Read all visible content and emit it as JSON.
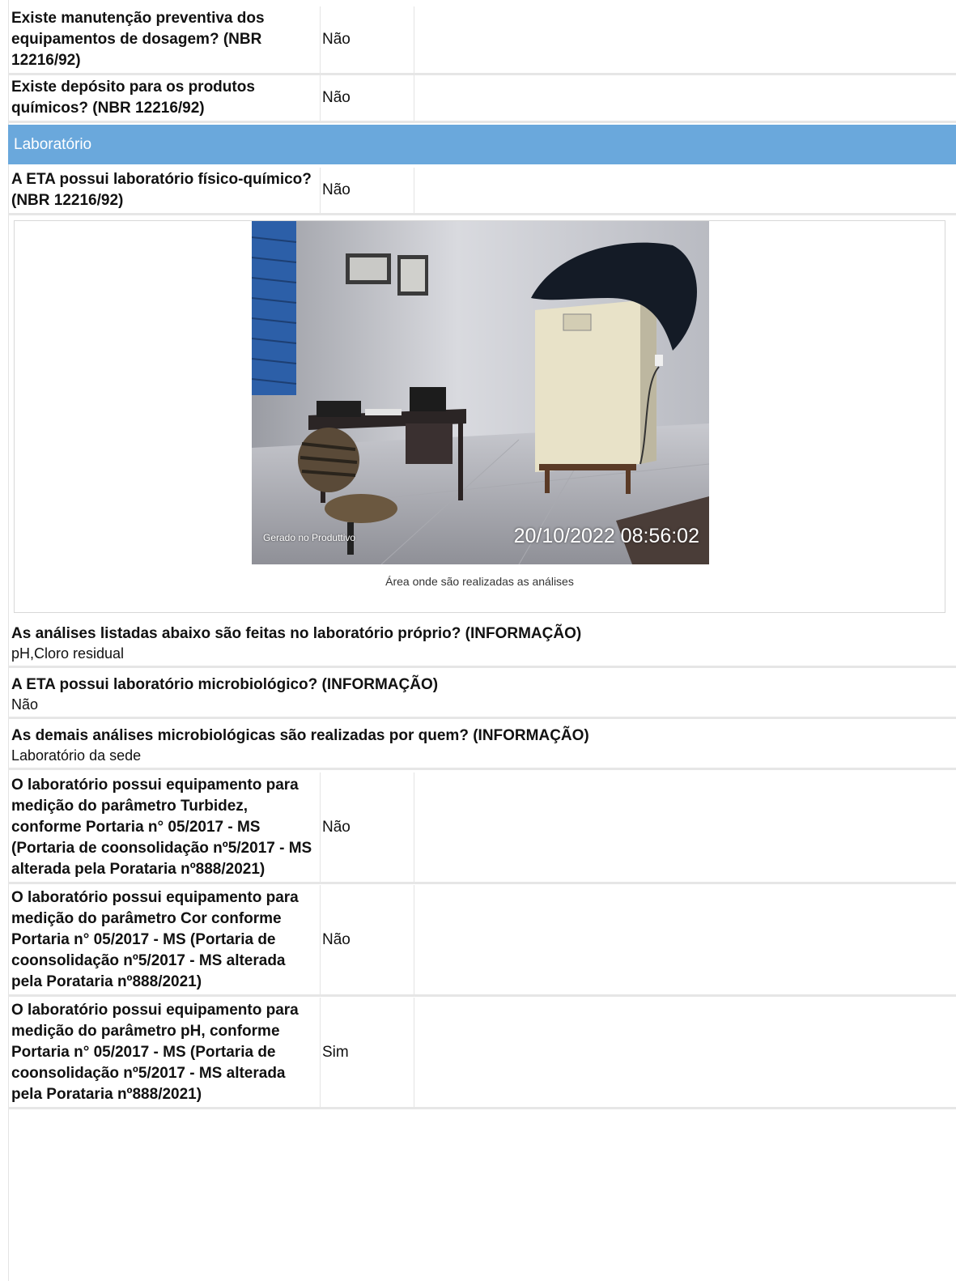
{
  "rows_top": [
    {
      "question": "Existe manutenção preventiva dos equipamentos de dosagem? (NBR 12216/92)",
      "answer": "Não"
    },
    {
      "question": "Existe depósito para os produtos químicos? (NBR 12216/92)",
      "answer": "Não"
    }
  ],
  "section": {
    "title": "Laboratório"
  },
  "lab_row": {
    "question": "A ETA possui laboratório físico-químico? (NBR 12216/92)",
    "answer": "Não"
  },
  "photo": {
    "stamp": "20/10/2022 08:56:02",
    "generated": "Gerado no Produttivo",
    "caption": "Área onde são realizadas as análises"
  },
  "info_rows": [
    {
      "question": "As análises listadas abaixo são feitas no laboratório próprio? (INFORMAÇÃO)",
      "answer": "pH,Cloro residual"
    },
    {
      "question": "A ETA possui laboratório microbiológico? (INFORMAÇÃO)",
      "answer": "Não"
    },
    {
      "question": "As demais análises microbiológicas são realizadas por quem? (INFORMAÇÃO)",
      "answer": "Laboratório da sede"
    }
  ],
  "rows_bottom": [
    {
      "question": "O laboratório possui equipamento para medição do parâmetro Turbidez, conforme Portaria n° 05/2017 - MS (Portaria de coonsolidação nº5/2017 - MS alterada pela Porataria nº888/2021)",
      "answer": "Não"
    },
    {
      "question": "O laboratório possui equipamento para medição do parâmetro Cor conforme Portaria n° 05/2017 - MS (Portaria de coonsolidação nº5/2017 - MS alterada pela Porataria nº888/2021)",
      "answer": "Não"
    },
    {
      "question": "O laboratório possui equipamento para medição do parâmetro pH, conforme Portaria n° 05/2017 - MS (Portaria de coonsolidação nº5/2017 - MS alterada pela Porataria nº888/2021)",
      "answer": "Sim"
    }
  ],
  "colors": {
    "section_bar": "#6aa8dc",
    "divider": "#e6e6e6"
  }
}
